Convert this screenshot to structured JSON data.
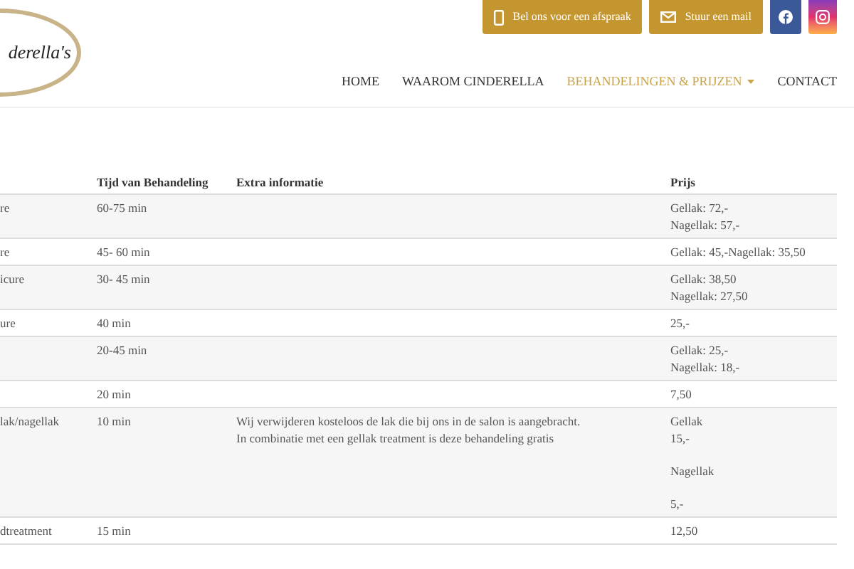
{
  "logo": {
    "text": "derella's"
  },
  "contact_buttons": [
    {
      "kind": "phone",
      "label": "Bel ons voor een afspraak"
    },
    {
      "kind": "mail",
      "label": "Stuur een mail"
    }
  ],
  "social_buttons": [
    {
      "kind": "facebook"
    },
    {
      "kind": "instagram"
    }
  ],
  "nav": [
    {
      "label": "HOME",
      "selected": false,
      "dropdown": false
    },
    {
      "label": "WAAROM CINDERELLA",
      "selected": false,
      "dropdown": false
    },
    {
      "label": "BEHANDELINGEN & PRIJZEN",
      "selected": true,
      "dropdown": true
    },
    {
      "label": "CONTACT",
      "selected": false,
      "dropdown": false
    }
  ],
  "table": {
    "columns": [
      "Tijd van Behandeling",
      "Extra informatie",
      "Prijs"
    ],
    "rows": [
      {
        "name": "re",
        "time": "60-75 min",
        "price": [
          [
            "Gellak: 72,-",
            "Nagellak: 57,-"
          ]
        ]
      },
      {
        "name": "re",
        "time": "45- 60 min",
        "price": [
          [
            "Gellak: 45,-Nagellak: 35,50"
          ]
        ]
      },
      {
        "name": "icure",
        "time": "30- 45 min",
        "price": [
          [
            "Gellak: 38,50",
            "Nagellak: 27,50"
          ]
        ]
      },
      {
        "name": "ure",
        "time": "40 min",
        "price": [
          [
            "25,-"
          ]
        ]
      },
      {
        "time": "20-45 min",
        "price": [
          [
            "Gellak: 25,-",
            "Nagellak: 18,-"
          ]
        ]
      },
      {
        "time": "20 min",
        "price": [
          [
            "7,50"
          ]
        ]
      },
      {
        "name": "lak/nagellak",
        "time": "10 min",
        "extra": "Wij verwijderen kosteloos de lak die bij ons in de salon is aangebracht.\nIn combinatie met een gellak treatment is deze behandeling gratis",
        "price": [
          [
            "Gellak",
            "15,-"
          ],
          [
            "Nagellak"
          ],
          [
            "5,-"
          ]
        ]
      },
      {
        "name": "dtreatment",
        "time": "15 min",
        "price": [
          [
            "12,50"
          ]
        ]
      }
    ]
  }
}
